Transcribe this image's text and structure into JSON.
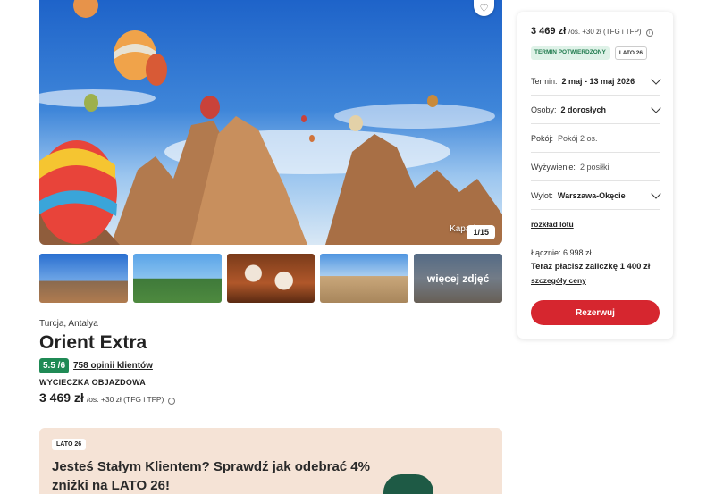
{
  "gallery": {
    "caption": "Kapad",
    "counter": "1/15",
    "more_label": "więcej zdjęć"
  },
  "offer": {
    "location": "Turcja, Antalya",
    "title": "Orient Extra",
    "rating": "5.5 /6",
    "reviews": "758 opinii klientów",
    "trip_type": "WYCIECZKA OBJAZDOWA",
    "price": "3 469 zł",
    "price_suffix": "/os. +30 zł (TFG i TFP)"
  },
  "promo": {
    "badge": "LATO 26",
    "text": "Jesteś Stałym Klientem? Sprawdź jak odebrać 4% zniżki na LATO 26!"
  },
  "booking": {
    "price": "3 469 zł",
    "price_suffix": "/os. +30 zł (TFG i TFP)",
    "badge_confirmed": "TERMIN POTWIERDZONY",
    "badge_season": "LATO 26",
    "term_label": "Termin:",
    "term_value": "2 maj - 13 maj 2026",
    "persons_label": "Osoby:",
    "persons_value": "2 dorosłych",
    "room_label": "Pokój:",
    "room_value": "Pokój 2 os.",
    "board_label": "Wyżywienie:",
    "board_value": "2 posiłki",
    "departure_label": "Wylot:",
    "departure_value": "Warszawa-Okęcie",
    "flight_schedule_link": "rozkład lotu",
    "total": "Łącznie: 6 998 zł",
    "deposit": "Teraz płacisz zaliczkę 1 400 zł",
    "price_details_link": "szczegóły ceny",
    "reserve_button": "Rezerwuj"
  },
  "colors": {
    "primary": "#d6262f",
    "rating_green": "#1f8a55",
    "promo_bg": "#f5e3d6"
  }
}
